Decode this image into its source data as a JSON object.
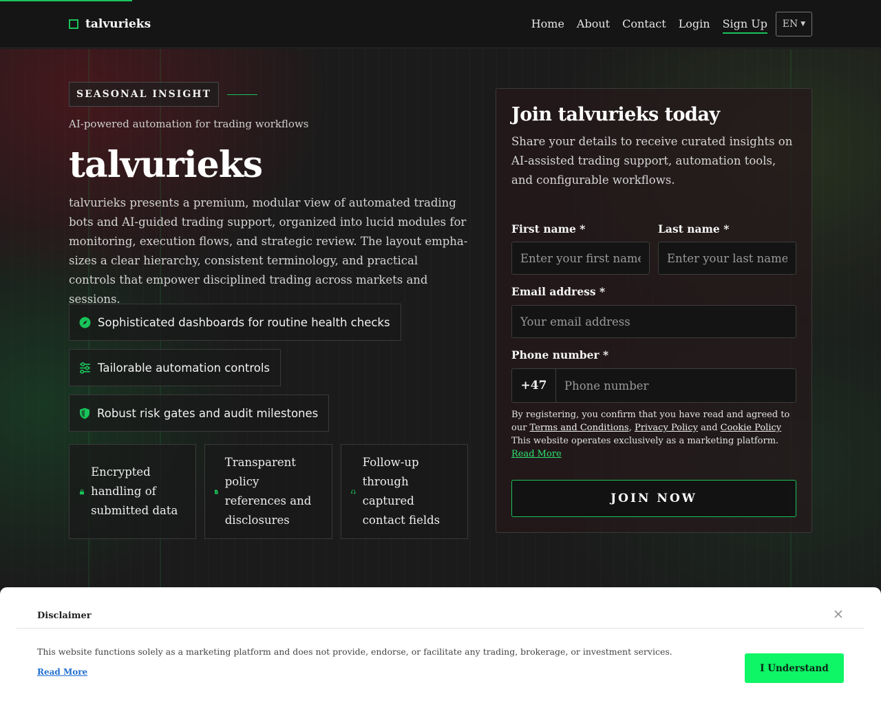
{
  "brand": {
    "name": "talvurieks"
  },
  "nav": {
    "items": [
      "Home",
      "About",
      "Contact",
      "Login",
      "Sign Up"
    ],
    "language": "EN"
  },
  "hero": {
    "eyebrow": "SEASONAL INSIGHT",
    "tagline": "AI-powered automation for trading workflows",
    "title": "talvurieks",
    "description": "talvurieks presents a premium, modular view of automated trading bots and AI-guided trading support, organized into lucid modules for monitoring, execution flows, and strategic review. The layout empha-sizes a clear hierarchy, consistent terminology, and practical controls that empower disciplined trading across markets and sessions.",
    "features": [
      {
        "icon": "compass-icon",
        "text": "Sophisticated dashboards for routine health checks"
      },
      {
        "icon": "sliders-icon",
        "text": "Tailorable automation controls"
      },
      {
        "icon": "shield-icon",
        "text": "Robust risk gates and audit milestones"
      }
    ],
    "cards": [
      {
        "icon": "lock-icon",
        "text": "Encrypted handling of submitted data"
      },
      {
        "icon": "document-icon",
        "text": "Transparent policy references and disclosures"
      },
      {
        "icon": "headset-icon",
        "text": "Follow-up through captured contact fields"
      }
    ]
  },
  "form": {
    "title": "Join talvurieks today",
    "subtitle": "Share your details to receive curated insights on AI-assisted trading support, automation tools, and configurable workflows.",
    "first_name_label": "First name *",
    "first_name_placeholder": "Enter your first name",
    "last_name_label": "Last name *",
    "last_name_placeholder": "Enter your last name",
    "email_label": "Email address *",
    "email_placeholder": "Your email address",
    "phone_label": "Phone number *",
    "phone_prefix": "+47",
    "phone_placeholder": "Phone number",
    "legal_prefix": "By registering, you confirm that you have read and agreed to our ",
    "terms": "Terms and Conditions",
    "comma": ", ",
    "privacy": "Privacy Policy",
    "and": " and ",
    "cookie": "Cookie Policy",
    "legal_suffix": " This website operates exclusively as a marketing platform. ",
    "read_more": "Read More",
    "submit": "JOIN NOW"
  },
  "disclaimer": {
    "title": "Disclaimer",
    "text": "This website functions solely as a marketing platform and does not provide, endorse, or facilitate any trading, brokerage, or investment services.",
    "read_more": "Read More",
    "button": "I Understand"
  },
  "colors": {
    "accent": "#19c45a",
    "button_green": "#0ef566",
    "link_blue": "#1f6fd1"
  }
}
